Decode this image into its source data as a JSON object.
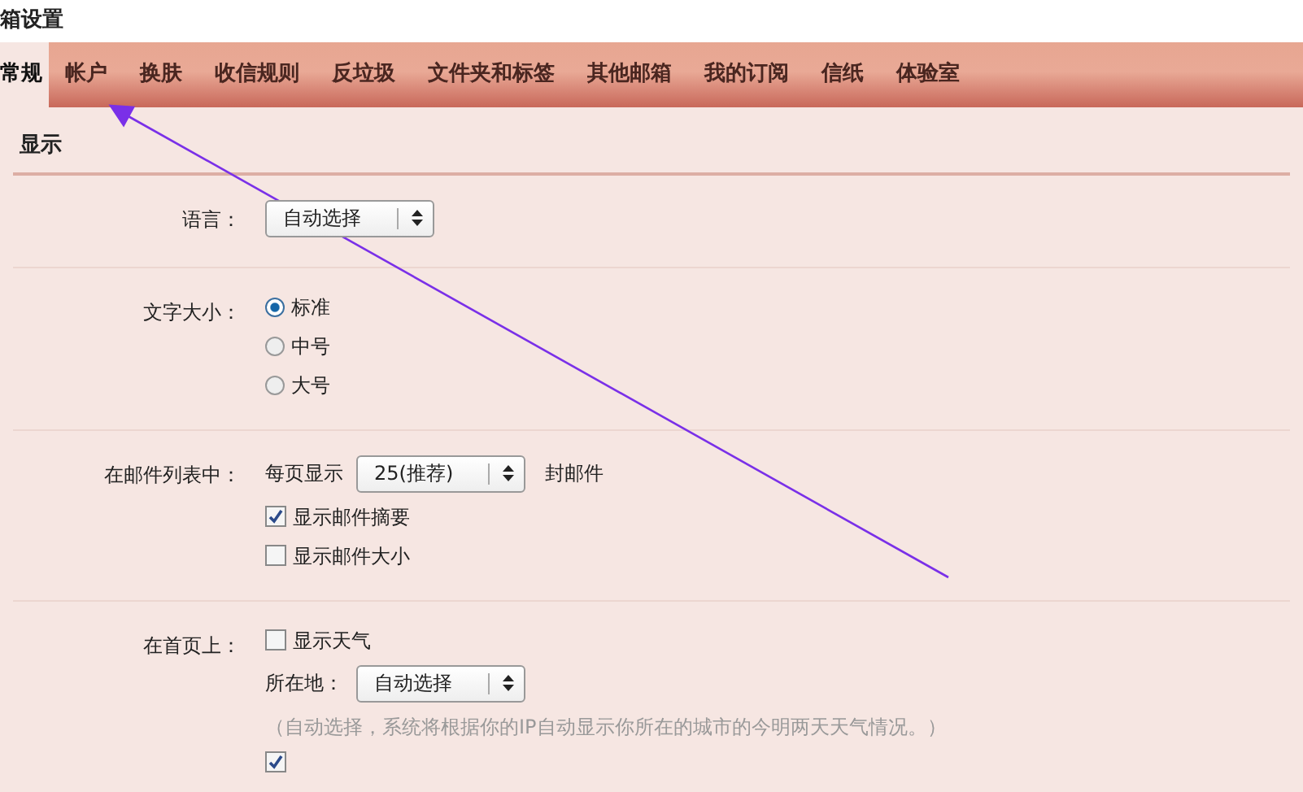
{
  "window": {
    "title": "箱设置"
  },
  "tabs": [
    {
      "label": "常规",
      "selected": true
    },
    {
      "label": "帐户",
      "selected": false
    },
    {
      "label": "换肤",
      "selected": false
    },
    {
      "label": "收信规则",
      "selected": false
    },
    {
      "label": "反垃圾",
      "selected": false
    },
    {
      "label": "文件夹和标签",
      "selected": false
    },
    {
      "label": "其他邮箱",
      "selected": false
    },
    {
      "label": "我的订阅",
      "selected": false
    },
    {
      "label": "信纸",
      "selected": false
    },
    {
      "label": "体验室",
      "selected": false
    }
  ],
  "section": {
    "title": "显示"
  },
  "rows": [
    {
      "label": "语言：",
      "items": [
        {
          "kind": "select",
          "value": "自动选择"
        }
      ]
    },
    {
      "label": "文字大小：",
      "items": [
        {
          "kind": "radio",
          "label": "标准",
          "selected": true
        },
        {
          "kind": "radio",
          "label": "中号",
          "selected": false
        },
        {
          "kind": "radio",
          "label": "大号",
          "selected": false
        }
      ]
    },
    {
      "label": "在邮件列表中：",
      "items": [
        {
          "kind": "inline_select",
          "before": "每页显示",
          "value": "25(推荐)",
          "after": "封邮件"
        },
        {
          "kind": "checkbox",
          "label": "显示邮件摘要",
          "checked": true
        },
        {
          "kind": "checkbox",
          "label": "显示邮件大小",
          "checked": false
        }
      ]
    },
    {
      "label": "在首页上：",
      "items": [
        {
          "kind": "checkbox",
          "label": "显示天气",
          "checked": false
        },
        {
          "kind": "inline_select",
          "before": "所在地：",
          "value": "自动选择"
        },
        {
          "kind": "note",
          "text": "（自动选择，系统将根据你的IP自动显示你所在的城市的今明两天天气情况。）"
        },
        {
          "kind": "checkbox",
          "checked": true
        }
      ]
    }
  ],
  "annotation": {
    "kind": "arrow"
  }
}
